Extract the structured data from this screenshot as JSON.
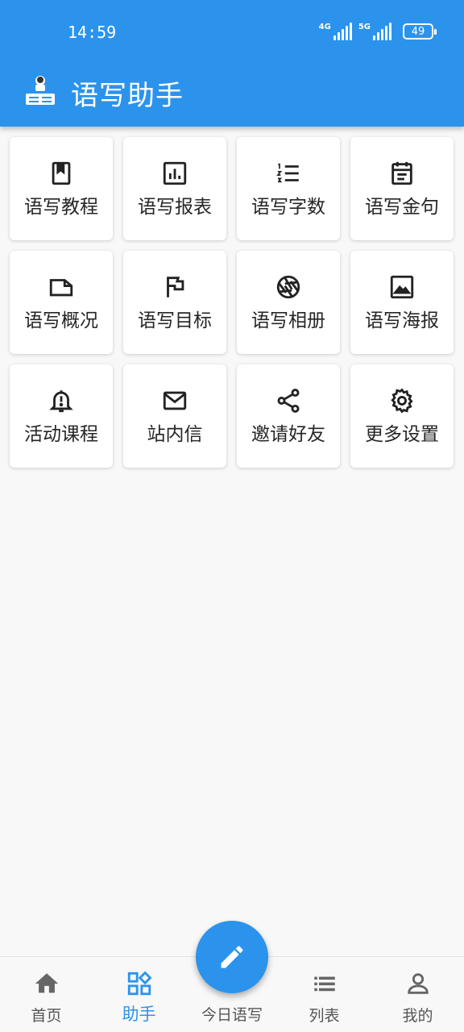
{
  "status_bar": {
    "time": "14:59",
    "signal_1_label": "4G",
    "signal_2_label": "5G",
    "battery": "49"
  },
  "app_bar": {
    "logo_icon": "app-logo-icon",
    "title": "语写助手"
  },
  "colors": {
    "primary": "#2b93ec",
    "background": "#f8f8f8",
    "card": "#ffffff",
    "text": "#262626"
  },
  "grid": [
    {
      "label": "语写教程",
      "icon": "book-icon"
    },
    {
      "label": "语写报表",
      "icon": "chart-icon"
    },
    {
      "label": "语写字数",
      "icon": "numbered-list-icon"
    },
    {
      "label": "语写金句",
      "icon": "calendar-note-icon"
    },
    {
      "label": "语写概况",
      "icon": "note-icon"
    },
    {
      "label": "语写目标",
      "icon": "flag-icon"
    },
    {
      "label": "语写相册",
      "icon": "camera-aperture-icon"
    },
    {
      "label": "语写海报",
      "icon": "image-icon"
    },
    {
      "label": "活动课程",
      "icon": "bell-alert-icon"
    },
    {
      "label": "站内信",
      "icon": "mail-icon"
    },
    {
      "label": "邀请好友",
      "icon": "share-icon"
    },
    {
      "label": "更多设置",
      "icon": "gear-icon"
    }
  ],
  "bottom_nav": {
    "home": {
      "label": "首页",
      "icon": "home-icon"
    },
    "assistant": {
      "label": "助手",
      "icon": "widgets-icon",
      "active": true
    },
    "today": {
      "label": "今日语写",
      "icon": "pencil-icon"
    },
    "list": {
      "label": "列表",
      "icon": "list-icon"
    },
    "mine": {
      "label": "我的",
      "icon": "person-icon"
    }
  }
}
